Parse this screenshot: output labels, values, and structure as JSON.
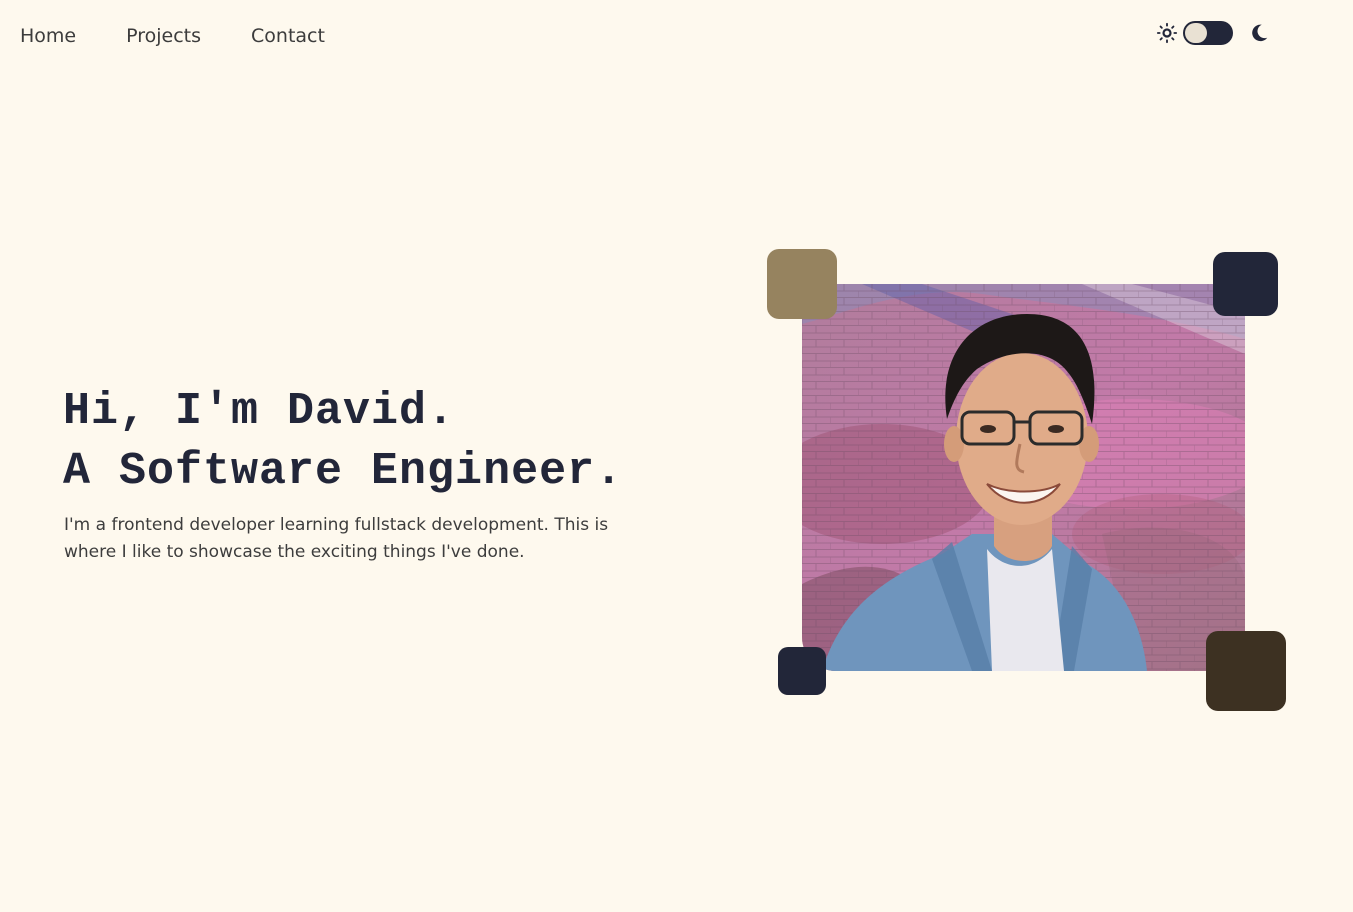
{
  "nav": {
    "items": [
      {
        "label": "Home"
      },
      {
        "label": "Projects"
      },
      {
        "label": "Contact"
      }
    ]
  },
  "theme_toggle": {
    "left_icon": "sun-icon",
    "right_icon": "moon-icon",
    "state": "light"
  },
  "hero": {
    "heading_line1": "Hi, I'm David.",
    "heading_line2": "A Software Engineer.",
    "description": "I'm a frontend developer learning fullstack development. This is where I like to showcase the exciting things I've done."
  },
  "colors": {
    "background": "#fef9ee",
    "navy": "#222639",
    "tan": "#96835f",
    "brown": "#3d3122"
  }
}
